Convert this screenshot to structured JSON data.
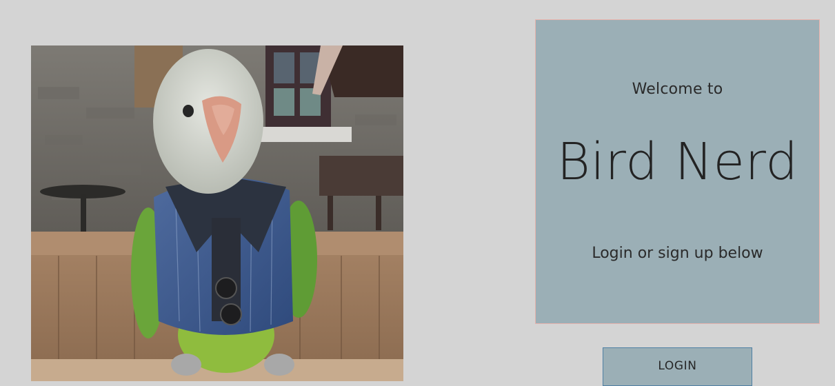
{
  "hero": {
    "image_alt": "parrot-in-vest-photo"
  },
  "welcome_card": {
    "welcome": "Welcome to",
    "title": "Bird Nerd",
    "subtitle": "Login or sign up below"
  },
  "auth": {
    "login_label": "LOGIN"
  },
  "colors": {
    "page_background": "#d4d4d4",
    "card_background": "#9bafb6",
    "card_border": "#e7b3ad",
    "button_border": "#4e7fa3"
  }
}
